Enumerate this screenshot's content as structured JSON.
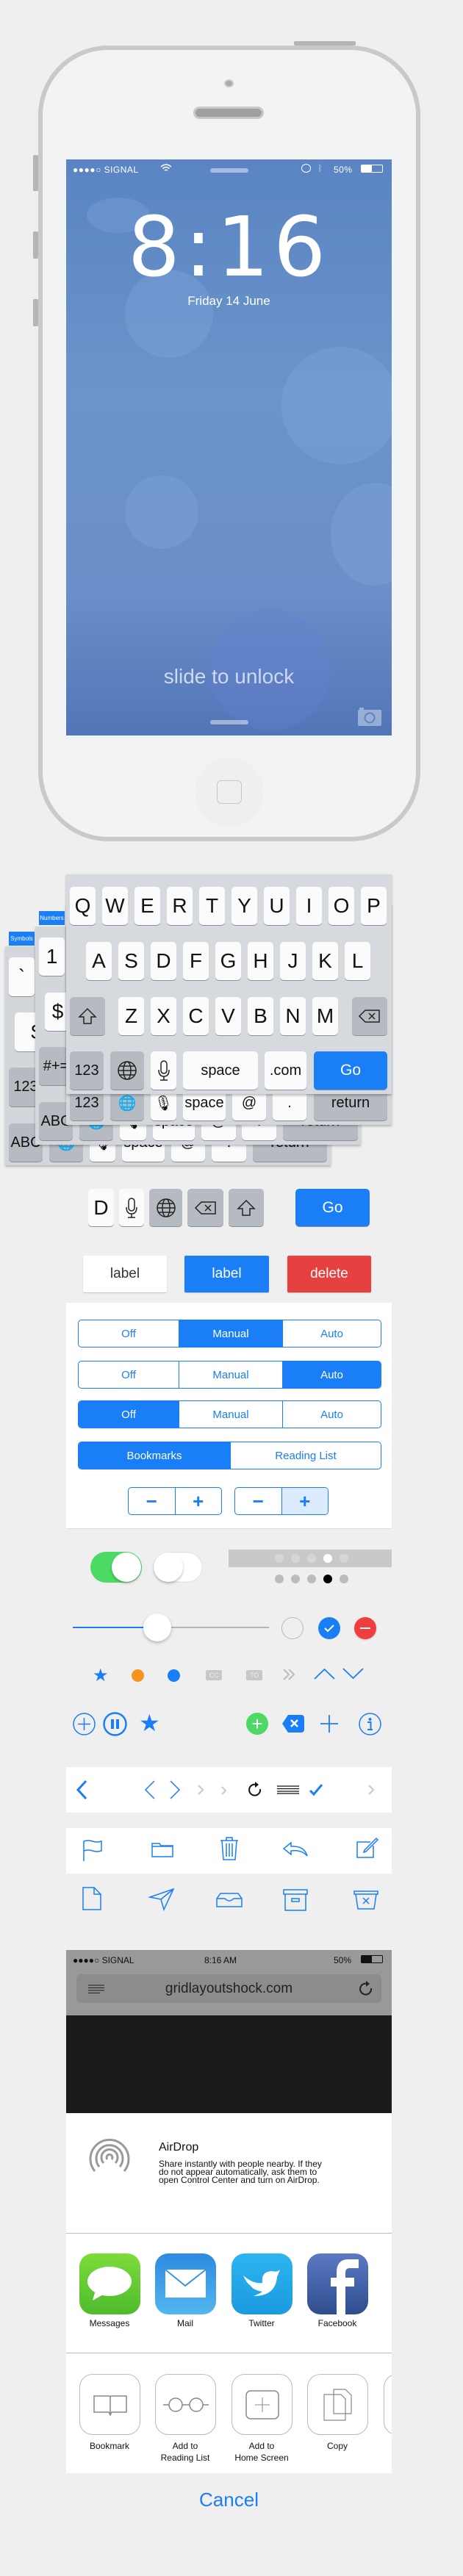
{
  "colors": {
    "accent": "#1a7ef6",
    "danger": "#e74040",
    "success": "#4cd964",
    "background": "#efefef"
  },
  "lockscreen": {
    "carrier": "●●●●○ SIGNAL",
    "battery": "50%",
    "time": "8:16",
    "date": "Friday 14 June",
    "slide": "slide to unlock",
    "battery_level": 0.5
  },
  "keyboard": {
    "rows": [
      [
        "Q",
        "W",
        "E",
        "R",
        "T",
        "Y",
        "U",
        "I",
        "O",
        "P"
      ],
      [
        "A",
        "S",
        "D",
        "F",
        "G",
        "H",
        "J",
        "K",
        "L"
      ],
      [
        "Z",
        "X",
        "C",
        "V",
        "B",
        "N",
        "M"
      ]
    ],
    "numbers_key": "123",
    "space": "space",
    "dotcom": ".com",
    "go": "Go",
    "email_row": {
      "numbers": "123",
      "space": "space",
      "at": "@",
      "dot": ".",
      "return": "return"
    },
    "numbers_tab": "Numbers",
    "numbers_keys": {
      "one": "1",
      "dollar": "$",
      "symbols": "#+=",
      "abc": "ABC",
      "space": "space",
      "at": "@",
      "dot": ".",
      "return": "return"
    },
    "symbols_tab": "Symbols",
    "symbols_keys": {
      "backtick": "`",
      "dollar": "$",
      "numbers": "123",
      "abc": "ABC",
      "space": "space",
      "at": "@",
      "dot": ".",
      "return": "return"
    }
  },
  "keys_sample": {
    "letter": "D",
    "go": "Go"
  },
  "buttons": {
    "default": "label",
    "primary": "label",
    "delete": "delete"
  },
  "segments": [
    {
      "items": [
        "Off",
        "Manual",
        "Auto"
      ],
      "selected": 1
    },
    {
      "items": [
        "Off",
        "Manual",
        "Auto"
      ],
      "selected": 2
    },
    {
      "items": [
        "Off",
        "Manual",
        "Auto"
      ],
      "selected": 0
    },
    {
      "items": [
        "Bookmarks",
        "Reading List"
      ],
      "selected": 0
    }
  ],
  "steppers": [
    {
      "minus": "−",
      "plus": "+",
      "pressed": null
    },
    {
      "minus": "−",
      "plus": "+",
      "pressed": "plus"
    }
  ],
  "toggles": [
    {
      "on": true
    },
    {
      "on": false
    }
  ],
  "page_control": {
    "count": 5,
    "current": 3
  },
  "slider": {
    "value": 0.43
  },
  "badges": {
    "cc": "CC",
    "to": "TO"
  },
  "browser": {
    "carrier": "●●●●○ SIGNAL",
    "time": "8:16 AM",
    "battery": "50%",
    "url": "gridlayoutshock.com"
  },
  "share": {
    "airdrop_title": "AirDrop",
    "airdrop_text": [
      "Share instantly with people nearby. If they",
      "do not appear automatically, ask them to",
      "open Control Center and turn on AirDrop."
    ],
    "apps": [
      "Messages",
      "Mail",
      "Twitter",
      "Facebook"
    ],
    "actions": [
      [
        "Bookmark",
        ""
      ],
      [
        "Add to",
        "Reading List"
      ],
      [
        "Add to",
        "Home Screen"
      ],
      [
        "Copy",
        ""
      ]
    ],
    "cancel": "Cancel"
  }
}
